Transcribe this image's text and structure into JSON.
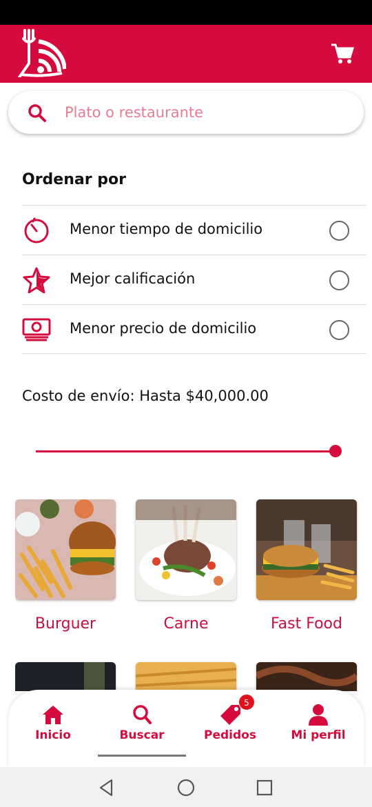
{
  "app": {
    "brand_color": "#d50b3e",
    "icons": {
      "logo": "restaurant-wifi-logo",
      "cart": "shopping-cart-icon"
    }
  },
  "search": {
    "placeholder": "Plato o restaurante",
    "value": "",
    "icon": "search-icon"
  },
  "sort": {
    "title": "Ordenar por",
    "options": [
      {
        "label": "Menor tiempo de domicilio",
        "icon": "timer-icon",
        "selected": false
      },
      {
        "label": "Mejor calificación",
        "icon": "star-icon",
        "selected": false
      },
      {
        "label": "Menor precio de domicilio",
        "icon": "money-icon",
        "selected": false
      }
    ]
  },
  "shipping": {
    "label": "Costo de envío: Hasta $40,000.00",
    "slider_fraction": 1.0
  },
  "categories": [
    {
      "label": "Burguer",
      "image": "burger-photo"
    },
    {
      "label": "Carne",
      "image": "meat-photo"
    },
    {
      "label": "Fast Food",
      "image": "fast-food-photo"
    },
    {
      "label": "",
      "image": "dark-drink-photo"
    },
    {
      "label": "",
      "image": "fries-photo"
    },
    {
      "label": "",
      "image": "grilled-meat-photo"
    }
  ],
  "bottom_nav": {
    "items": [
      {
        "label": "Inicio",
        "icon": "home-icon"
      },
      {
        "label": "Buscar",
        "icon": "search-icon",
        "active": true
      },
      {
        "label": "Pedidos",
        "icon": "tag-icon",
        "badge": "5"
      },
      {
        "label": "Mi perfil",
        "icon": "person-icon"
      }
    ]
  }
}
